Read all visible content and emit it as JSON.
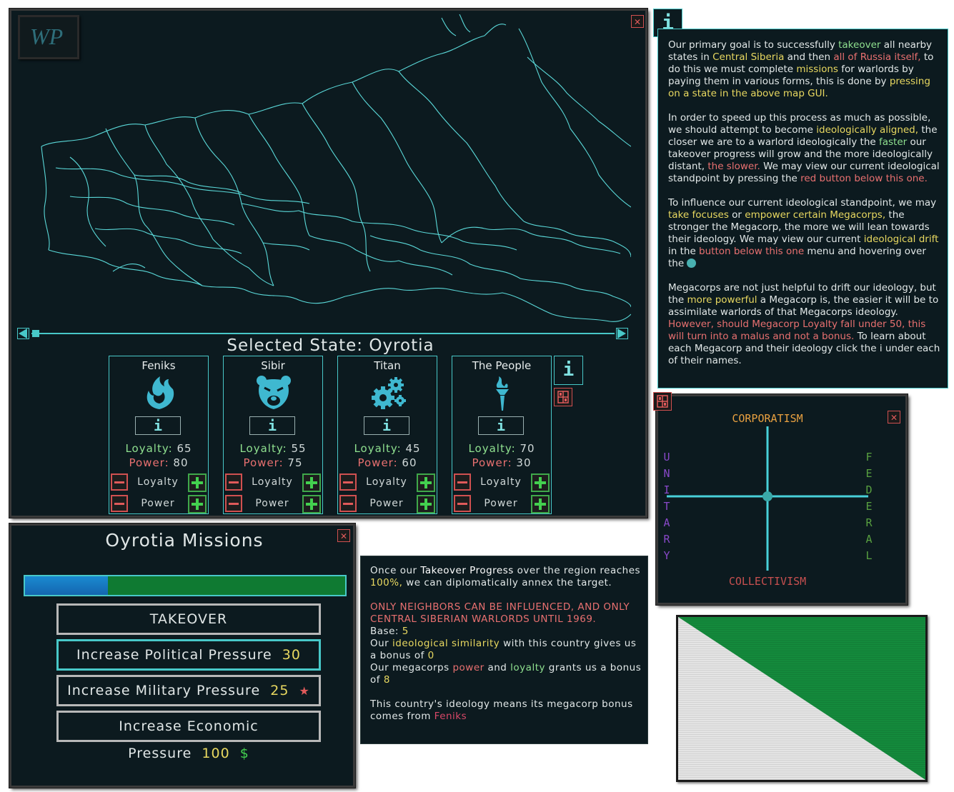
{
  "map_panel": {
    "logo_text": "WP",
    "selected_state_label": "Selected State: Oyrotia"
  },
  "megacorps": [
    {
      "name": "Feniks",
      "icon": "phoenix-icon",
      "info_label": "i",
      "loyalty_label": "Loyalty:",
      "loyalty": "65",
      "power_label": "Power:",
      "power": "80",
      "loyalty_row": "Loyalty",
      "power_row": "Power"
    },
    {
      "name": "Sibir",
      "icon": "bear-icon",
      "info_label": "i",
      "loyalty_label": "Loyalty:",
      "loyalty": "55",
      "power_label": "Power:",
      "power": "75",
      "loyalty_row": "Loyalty",
      "power_row": "Power"
    },
    {
      "name": "Titan",
      "icon": "gears-icon",
      "info_label": "i",
      "loyalty_label": "Loyalty:",
      "loyalty": "45",
      "power_label": "Power:",
      "power": "60",
      "loyalty_row": "Loyalty",
      "power_row": "Power"
    },
    {
      "name": "The People",
      "icon": "torch-icon",
      "info_label": "i",
      "loyalty_label": "Loyalty:",
      "loyalty": "70",
      "power_label": "Power:",
      "power": "30",
      "loyalty_row": "Loyalty",
      "power_row": "Power"
    }
  ],
  "side_info_label": "i",
  "info_panel": {
    "icon_label": "i",
    "p1": [
      "Our primary goal is to successfully ",
      "takeover",
      " all nearby states in ",
      "Central Siberia",
      " and then ",
      "all of Russia itself,",
      " to do this we must complete ",
      "missions",
      " for warlords by paying them in various forms, this is done by ",
      "pressing on a state in the above map GUI."
    ],
    "p2": [
      "In order to speed up this process as much as possible, we should attempt to become ",
      "ideologically aligned,",
      " the closer we are to a warlord ideologically the ",
      "faster",
      " our takeover progress will grow and the more ideologically distant, ",
      "the slower.",
      " We may view our current ideological standpoint by pressing the ",
      "red button below this one."
    ],
    "p3": [
      "To influence our current ideological standpoint, we may ",
      "take focuses",
      " or ",
      "empower certain Megacorps,",
      " the stronger the Megacorp, the more we will lean towards their ideology. We may view our current ",
      "ideological drift",
      " in the ",
      "button below this one",
      " menu and hovering over the "
    ],
    "p4": [
      "Megacorps are not just helpful to drift our ideology, but the ",
      "more powerful",
      " a Megacorp is, the easier it will be to assimilate warlords of that Megacorps ideology. ",
      "However, should Megacorp Loyalty fall under 50, this will turn into a malus and not a bonus.",
      " To learn about each Megacorp and their ideology click the i under each of their names."
    ]
  },
  "ideology": {
    "top": "CORPORATISM",
    "bottom": "COLLECTIVISM",
    "left": "UNITARY",
    "right": "FEDERAL",
    "colors": {
      "top": "#e8a040",
      "bottom": "#c85050",
      "left": "#8848c8",
      "right": "#58a040",
      "axis": "#48d0d8"
    }
  },
  "missions": {
    "title": "Oyrotia Missions",
    "progress": 0.26,
    "takeover_label": "TAKEOVER",
    "buttons": [
      {
        "label": "Increase Political Pressure",
        "cost": "30",
        "symbol": ""
      },
      {
        "label": "Increase Military Pressure",
        "cost": "25",
        "symbol": "★"
      },
      {
        "label": "Increase Economic Pressure",
        "cost": "100",
        "symbol": "$"
      }
    ]
  },
  "takeover_info": {
    "l1": [
      "Once our ",
      "Takeover Progress",
      " over the region reaches ",
      "100%,",
      " we can diplomatically annex the target."
    ],
    "warning": "ONLY NEIGHBORS CAN BE INFLUENCED, AND ONLY CENTRAL SIBERIAN WARLORDS UNTIL 1969.",
    "base": [
      "Base: ",
      "5"
    ],
    "similarity": [
      "Our ",
      "ideological similarity",
      " with this country gives us a bonus of ",
      "0"
    ],
    "megacorp": [
      "Our megacorps ",
      "power",
      " and ",
      "loyalty",
      " grants us a bonus of ",
      "8"
    ],
    "ideology_src": [
      "This country's ideology means its megacorp bonus comes from ",
      "Feniks"
    ]
  },
  "flag_colors": {
    "green": "#148a3c",
    "white": "#e4e4e4"
  }
}
